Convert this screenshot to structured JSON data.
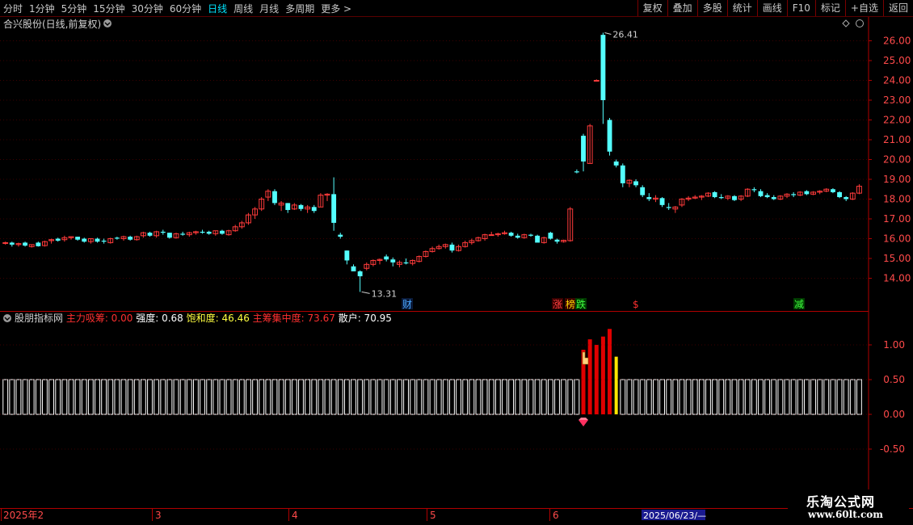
{
  "toolbar": {
    "periods": [
      "分时",
      "1分钟",
      "5分钟",
      "15分钟",
      "30分钟",
      "60分钟",
      "日线",
      "周线",
      "月线",
      "多周期",
      "更多 >"
    ],
    "active_period": "日线",
    "actions": [
      "复权",
      "叠加",
      "多股",
      "统计",
      "画线",
      "F10",
      "标记",
      "+自选",
      "返回"
    ]
  },
  "price_pane": {
    "title": "合兴股份(日线,前复权)",
    "high_label": "26.41",
    "low_label": "13.31",
    "y_axis_ticks": [
      "26.00",
      "25.00",
      "24.00",
      "23.00",
      "22.00",
      "21.00",
      "20.00",
      "19.00",
      "18.00",
      "17.00",
      "16.00",
      "15.00",
      "14.00"
    ],
    "markers": [
      {
        "text": "财",
        "color": "#4aa8ff",
        "bg": "#0a1a3a"
      },
      {
        "text": "涨",
        "color": "#ff4040",
        "bg": "#3a0000"
      },
      {
        "text": "榜",
        "color": "#ffd700",
        "bg": "#3a0000"
      },
      {
        "text": "跌",
        "color": "#40ff40",
        "bg": "#003a00"
      },
      {
        "text": "$",
        "color": "#ff3030",
        "bg": "#000000"
      },
      {
        "text": "减",
        "color": "#40ff40",
        "bg": "#003a00"
      }
    ]
  },
  "indicator_pane": {
    "name": "股朋指标网",
    "items": [
      {
        "label": "主力吸筹:",
        "value": "0.00",
        "color": "#ff3030"
      },
      {
        "label": "强度:",
        "value": "0.68",
        "color": "#ffffff"
      },
      {
        "label": "饱和度:",
        "value": "46.46",
        "color": "#ffff40"
      },
      {
        "label": "主筹集中度:",
        "value": "73.67",
        "color": "#ff3030"
      },
      {
        "label": "散户:",
        "value": "70.95",
        "color": "#ffffff"
      }
    ],
    "y_axis_ticks": [
      "1.00",
      "0.50",
      "0.00",
      "-0.50"
    ]
  },
  "date_axis": {
    "year_label": "2025年2",
    "month_labels": [
      "3",
      "4",
      "5",
      "6"
    ],
    "cursor_date": "2025/06/23/—"
  },
  "watermark": {
    "line1": "乐淘公式网",
    "line2": "www.60lt.com"
  },
  "colors": {
    "up": "#ff3b3b",
    "down": "#54ffff",
    "grid": "#7a0000",
    "axis": "#b00000",
    "ind_white": "#ffffff",
    "ind_red": "#e00000",
    "ind_yellow": "#ffe600"
  },
  "chart_data": {
    "type": "candlestick",
    "title": "合兴股份(日线,前复权)",
    "ylim": [
      13.0,
      27.0
    ],
    "ohlc": [
      [
        15.8,
        15.85,
        15.7,
        15.8
      ],
      [
        15.8,
        15.85,
        15.6,
        15.7
      ],
      [
        15.7,
        15.8,
        15.6,
        15.75
      ],
      [
        15.8,
        15.85,
        15.6,
        15.65
      ],
      [
        15.6,
        15.7,
        15.55,
        15.7
      ],
      [
        15.8,
        15.85,
        15.6,
        15.62
      ],
      [
        15.65,
        15.9,
        15.6,
        15.85
      ],
      [
        15.9,
        16.0,
        15.75,
        15.95
      ],
      [
        16.0,
        16.05,
        15.85,
        15.9
      ],
      [
        15.95,
        16.15,
        15.85,
        16.05
      ],
      [
        16.05,
        16.1,
        15.95,
        16.1
      ],
      [
        16.1,
        16.1,
        15.9,
        15.95
      ],
      [
        16.0,
        16.05,
        15.8,
        15.85
      ],
      [
        15.85,
        16.0,
        15.75,
        16.0
      ],
      [
        16.0,
        16.05,
        15.8,
        15.85
      ],
      [
        15.9,
        16.0,
        15.75,
        15.85
      ],
      [
        15.8,
        16.05,
        15.75,
        16.0
      ],
      [
        16.05,
        16.1,
        15.95,
        16.0
      ],
      [
        16.0,
        16.15,
        15.9,
        16.1
      ],
      [
        16.1,
        16.15,
        15.9,
        15.95
      ],
      [
        15.95,
        16.15,
        15.9,
        16.1
      ],
      [
        16.15,
        16.35,
        16.05,
        16.3
      ],
      [
        16.3,
        16.35,
        16.1,
        16.15
      ],
      [
        16.15,
        16.4,
        16.05,
        16.35
      ],
      [
        16.35,
        16.45,
        16.2,
        16.3
      ],
      [
        16.3,
        16.3,
        16.0,
        16.05
      ],
      [
        16.05,
        16.3,
        16.0,
        16.25
      ],
      [
        16.25,
        16.35,
        16.15,
        16.2
      ],
      [
        16.2,
        16.35,
        16.1,
        16.3
      ],
      [
        16.3,
        16.4,
        16.2,
        16.35
      ],
      [
        16.35,
        16.45,
        16.25,
        16.3
      ],
      [
        16.35,
        16.4,
        16.2,
        16.25
      ],
      [
        16.25,
        16.4,
        16.15,
        16.4
      ],
      [
        16.4,
        16.45,
        16.2,
        16.25
      ],
      [
        16.2,
        16.45,
        16.15,
        16.4
      ],
      [
        16.4,
        16.7,
        16.35,
        16.6
      ],
      [
        16.6,
        16.9,
        16.5,
        16.8
      ],
      [
        16.8,
        17.3,
        16.7,
        17.2
      ],
      [
        17.2,
        17.6,
        17.0,
        17.5
      ],
      [
        17.5,
        18.1,
        17.4,
        18.0
      ],
      [
        18.1,
        18.5,
        17.9,
        18.4
      ],
      [
        18.4,
        18.5,
        17.7,
        17.8
      ],
      [
        17.7,
        17.9,
        17.4,
        17.8
      ],
      [
        17.8,
        17.8,
        17.3,
        17.45
      ],
      [
        17.5,
        17.8,
        17.45,
        17.7
      ],
      [
        17.7,
        17.75,
        17.4,
        17.5
      ],
      [
        17.5,
        17.7,
        17.3,
        17.6
      ],
      [
        17.6,
        17.7,
        17.3,
        17.4
      ],
      [
        17.6,
        18.3,
        17.6,
        18.2
      ],
      [
        18.2,
        18.3,
        17.9,
        18.25
      ],
      [
        18.25,
        19.1,
        16.4,
        16.8
      ],
      [
        16.2,
        16.3,
        16.0,
        16.1
      ],
      [
        15.4,
        15.4,
        14.7,
        14.9
      ],
      [
        14.6,
        14.7,
        14.4,
        14.35
      ],
      [
        14.35,
        14.4,
        13.31,
        14.1
      ],
      [
        14.5,
        14.8,
        14.4,
        14.7
      ],
      [
        14.7,
        14.95,
        14.6,
        14.9
      ],
      [
        14.9,
        15.0,
        14.7,
        14.95
      ],
      [
        15.1,
        15.2,
        14.85,
        14.95
      ],
      [
        14.95,
        15.05,
        14.6,
        14.8
      ],
      [
        14.7,
        14.9,
        14.55,
        14.8
      ],
      [
        14.8,
        15.0,
        14.7,
        14.75
      ],
      [
        14.75,
        14.95,
        14.65,
        14.9
      ],
      [
        14.85,
        15.15,
        14.8,
        15.1
      ],
      [
        15.1,
        15.4,
        15.05,
        15.35
      ],
      [
        15.35,
        15.6,
        15.3,
        15.5
      ],
      [
        15.5,
        15.7,
        15.45,
        15.6
      ],
      [
        15.6,
        15.75,
        15.5,
        15.7
      ],
      [
        15.7,
        15.8,
        15.3,
        15.4
      ],
      [
        15.4,
        15.7,
        15.35,
        15.6
      ],
      [
        15.6,
        15.9,
        15.55,
        15.8
      ],
      [
        15.8,
        16.0,
        15.7,
        15.9
      ],
      [
        15.9,
        16.1,
        15.85,
        16.05
      ],
      [
        16.0,
        16.25,
        15.9,
        16.2
      ],
      [
        16.2,
        16.35,
        16.15,
        16.2
      ],
      [
        16.2,
        16.3,
        16.1,
        16.25
      ],
      [
        16.25,
        16.4,
        16.2,
        16.3
      ],
      [
        16.3,
        16.35,
        16.1,
        16.15
      ],
      [
        16.15,
        16.25,
        16.0,
        16.05
      ],
      [
        16.05,
        16.25,
        16.0,
        16.2
      ],
      [
        16.2,
        16.25,
        16.1,
        16.15
      ],
      [
        16.15,
        16.2,
        15.9,
        15.8
      ],
      [
        15.8,
        16.1,
        15.75,
        16.05
      ],
      [
        16.3,
        16.35,
        15.95,
        16.0
      ],
      [
        15.95,
        16.0,
        15.75,
        15.85
      ],
      [
        15.85,
        15.95,
        15.8,
        15.92
      ],
      [
        15.9,
        17.6,
        15.85,
        17.5
      ],
      [
        19.4,
        19.5,
        19.3,
        19.35
      ],
      [
        21.2,
        21.3,
        19.4,
        19.9
      ],
      [
        19.8,
        21.8,
        19.8,
        21.7
      ],
      [
        24.0,
        24.05,
        24.0,
        24.0
      ],
      [
        26.3,
        26.41,
        21.8,
        23.0
      ],
      [
        22.0,
        22.1,
        20.2,
        20.4
      ],
      [
        19.9,
        20.0,
        19.6,
        19.7
      ],
      [
        19.7,
        19.8,
        18.6,
        18.8
      ],
      [
        18.8,
        19.0,
        18.6,
        18.95
      ],
      [
        18.9,
        19.0,
        18.6,
        18.7
      ],
      [
        18.6,
        18.7,
        18.1,
        18.2
      ],
      [
        18.1,
        18.3,
        17.9,
        18.0
      ],
      [
        18.0,
        18.2,
        17.85,
        18.05
      ],
      [
        18.05,
        18.1,
        17.6,
        17.7
      ],
      [
        17.6,
        17.8,
        17.45,
        17.55
      ],
      [
        17.5,
        17.65,
        17.3,
        17.6
      ],
      [
        17.7,
        18.05,
        17.6,
        18.0
      ],
      [
        18.0,
        18.15,
        17.9,
        18.05
      ],
      [
        18.05,
        18.2,
        18.0,
        18.1
      ],
      [
        18.1,
        18.2,
        17.95,
        18.15
      ],
      [
        18.15,
        18.35,
        18.1,
        18.3
      ],
      [
        18.35,
        18.4,
        18.05,
        18.1
      ],
      [
        18.1,
        18.25,
        18.0,
        18.05
      ],
      [
        18.05,
        18.2,
        17.95,
        18.15
      ],
      [
        18.15,
        18.2,
        17.9,
        17.95
      ],
      [
        18.0,
        18.2,
        17.9,
        18.15
      ],
      [
        18.15,
        18.55,
        18.1,
        18.5
      ],
      [
        18.5,
        18.6,
        18.35,
        18.45
      ],
      [
        18.4,
        18.5,
        18.1,
        18.15
      ],
      [
        18.2,
        18.3,
        18.05,
        18.1
      ],
      [
        18.1,
        18.2,
        17.95,
        18.0
      ],
      [
        18.0,
        18.2,
        17.95,
        18.15
      ],
      [
        18.15,
        18.3,
        18.05,
        18.25
      ],
      [
        18.25,
        18.35,
        18.1,
        18.2
      ],
      [
        18.2,
        18.4,
        18.15,
        18.35
      ],
      [
        18.4,
        18.45,
        18.2,
        18.25
      ],
      [
        18.25,
        18.4,
        18.2,
        18.35
      ],
      [
        18.35,
        18.45,
        18.25,
        18.4
      ],
      [
        18.4,
        18.55,
        18.35,
        18.5
      ],
      [
        18.5,
        18.55,
        18.3,
        18.35
      ],
      [
        18.35,
        18.4,
        18.05,
        18.1
      ],
      [
        18.1,
        18.15,
        17.9,
        18.0
      ],
      [
        18.0,
        18.35,
        17.95,
        18.3
      ],
      [
        18.3,
        18.75,
        18.25,
        18.65
      ]
    ],
    "indicator_bars": {
      "white_value": 0.5,
      "red_values": [
        0.93,
        1.08,
        1.0,
        1.12,
        1.23
      ],
      "yellow_value": 0.83
    }
  }
}
